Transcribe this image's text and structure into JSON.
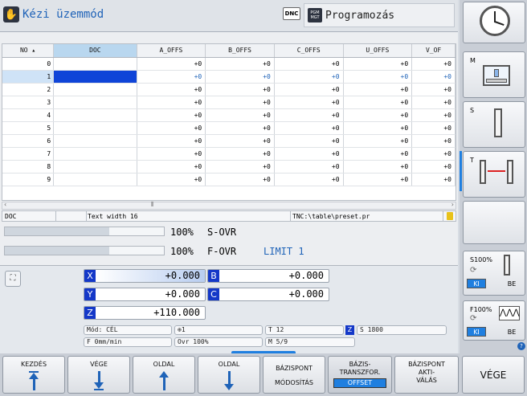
{
  "header": {
    "mode": "Kézi üzemmód",
    "dnc": "DNC",
    "pgm_top": "PGM",
    "pgm_bot": "MGT",
    "program": "Programozás"
  },
  "table": {
    "columns": [
      "NO",
      "DOC",
      "A_OFFS",
      "B_OFFS",
      "C_OFFS",
      "U_OFFS",
      "V_OF"
    ],
    "rows": [
      {
        "no": "0",
        "a": "+0",
        "b": "+0",
        "c": "+0",
        "u": "+0",
        "v": "+0"
      },
      {
        "no": "1",
        "a": "+0",
        "b": "+0",
        "c": "+0",
        "u": "+0",
        "v": "+0"
      },
      {
        "no": "2",
        "a": "+0",
        "b": "+0",
        "c": "+0",
        "u": "+0",
        "v": "+0"
      },
      {
        "no": "3",
        "a": "+0",
        "b": "+0",
        "c": "+0",
        "u": "+0",
        "v": "+0"
      },
      {
        "no": "4",
        "a": "+0",
        "b": "+0",
        "c": "+0",
        "u": "+0",
        "v": "+0"
      },
      {
        "no": "5",
        "a": "+0",
        "b": "+0",
        "c": "+0",
        "u": "+0",
        "v": "+0"
      },
      {
        "no": "6",
        "a": "+0",
        "b": "+0",
        "c": "+0",
        "u": "+0",
        "v": "+0"
      },
      {
        "no": "7",
        "a": "+0",
        "b": "+0",
        "c": "+0",
        "u": "+0",
        "v": "+0"
      },
      {
        "no": "8",
        "a": "+0",
        "b": "+0",
        "c": "+0",
        "u": "+0",
        "v": "+0"
      },
      {
        "no": "9",
        "a": "+0",
        "b": "+0",
        "c": "+0",
        "u": "+0",
        "v": "+0"
      }
    ],
    "selected_row": 1
  },
  "status": {
    "field": "DOC",
    "hint": "Text width 16",
    "file": "TNC:\\table\\preset.pr"
  },
  "override": {
    "s_pct": "100%",
    "s_label": "S-OVR",
    "f_pct": "100%",
    "f_label": "F-OVR",
    "limit": "LIMIT 1",
    "s_level": 1.0,
    "f_level": 1.0
  },
  "position": {
    "x_label": "X",
    "x": "+0.000",
    "y_label": "Y",
    "y": "+0.000",
    "z_label": "Z",
    "z": "+110.000",
    "b_label": "B",
    "b": "+0.000",
    "c_label": "C",
    "c": "+0.000"
  },
  "info": {
    "mode": "Mód: CÉL",
    "preset": "1",
    "tool": "T 12",
    "axis": "Z",
    "speed": "S 1800",
    "feed": "F 0mm/min",
    "ovr": "Ovr 100%",
    "mfunc": "M 5/9"
  },
  "softkeys": {
    "start": "KEZDÉS",
    "end": "VÉGE",
    "page1": "OLDAL",
    "page2": "OLDAL",
    "preset_mod1": "BÁZISPONT",
    "preset_mod2": "MÓDOSÍTÁS",
    "transf1": "BÁZIS-",
    "transf2": "TRANSZFOR.",
    "transf3": "OFFSET",
    "act1": "BÁZISPONT",
    "act2": "AKTI-",
    "act3": "VÁLÁS",
    "exit": "VÉGE"
  },
  "vertical": {
    "m": "M",
    "s": "S",
    "t": "T",
    "s100": "S100%",
    "f100": "F100%",
    "ki": "KI",
    "be": "BE",
    "ki2": "KI",
    "be2": "BE"
  },
  "colors": {
    "accent": "#1f63b8",
    "axis_blue": "#1438c8",
    "selection": "#0f44d8"
  }
}
